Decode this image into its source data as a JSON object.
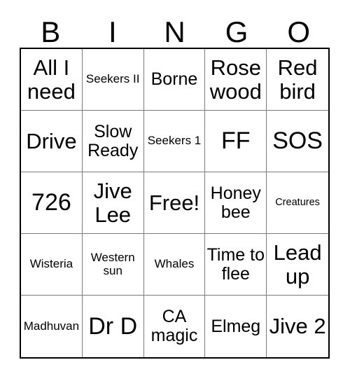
{
  "card": {
    "headers": [
      "B",
      "I",
      "N",
      "G",
      "O"
    ],
    "rows": [
      [
        {
          "text": "All I need",
          "size": "sz-lg"
        },
        {
          "text": "Seekers II",
          "size": "sz-sm"
        },
        {
          "text": "Borne",
          "size": "sz-md"
        },
        {
          "text": "Rose wood",
          "size": "sz-lg"
        },
        {
          "text": "Red bird",
          "size": "sz-lg"
        }
      ],
      [
        {
          "text": "Drive",
          "size": "sz-lg"
        },
        {
          "text": "Slow Ready",
          "size": "sz-md"
        },
        {
          "text": "Seekers 1",
          "size": "sz-sm"
        },
        {
          "text": "FF",
          "size": "sz-xl"
        },
        {
          "text": "SOS",
          "size": "sz-xl"
        }
      ],
      [
        {
          "text": "726",
          "size": "sz-xl"
        },
        {
          "text": "Jive Lee",
          "size": "sz-lg"
        },
        {
          "text": "Free!",
          "size": "sz-lg"
        },
        {
          "text": "Honey bee",
          "size": "sz-md"
        },
        {
          "text": "Creatures",
          "size": "sz-xs"
        }
      ],
      [
        {
          "text": "Wisteria",
          "size": "sz-sm"
        },
        {
          "text": "Western sun",
          "size": "sz-sm"
        },
        {
          "text": "Whales",
          "size": "sz-sm"
        },
        {
          "text": "Time to flee",
          "size": "sz-md"
        },
        {
          "text": "Lead up",
          "size": "sz-lg"
        }
      ],
      [
        {
          "text": "Madhuvan",
          "size": "sz-sm"
        },
        {
          "text": "Dr D",
          "size": "sz-xl"
        },
        {
          "text": "CA magic",
          "size": "sz-md"
        },
        {
          "text": "Elmeg",
          "size": "sz-md"
        },
        {
          "text": "Jive 2",
          "size": "sz-lg"
        }
      ]
    ],
    "colors": {
      "background": "#ffffff",
      "text": "#000000",
      "outer_border": "#000000",
      "inner_border": "#7d7d7d"
    }
  }
}
